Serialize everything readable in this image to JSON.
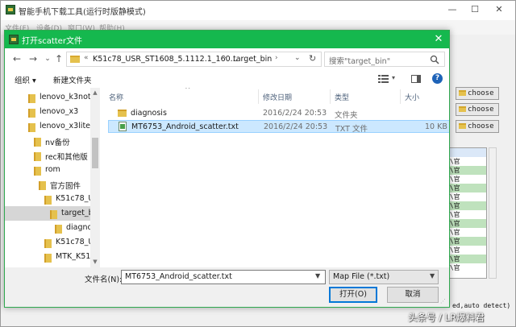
{
  "background_window": {
    "title": "智能手机下载工具(运行时版静模式)",
    "menu": [
      "文件(F)",
      "设备(D)",
      "窗口(W)",
      "帮助(H)"
    ],
    "controls": {
      "minimize": "—",
      "maximize": "☐",
      "close": "✕"
    },
    "choose_buttons": [
      "choose",
      "choose",
      "choose"
    ],
    "panel_rows": [
      "",
      "n\\官",
      "n\\官",
      "n\\官",
      "n\\官",
      "n\\官",
      "n\\官",
      "n\\官",
      "n\\官",
      "n\\官",
      "n\\官",
      "n\\官",
      "n\\官",
      "n\\官"
    ],
    "log_text": "ed,auto detect)"
  },
  "dialog": {
    "title": "打开scatter文件",
    "close": "✕",
    "nav": {
      "back": "←",
      "forward": "→",
      "dropdown": "⌄",
      "up": "↑"
    },
    "address": {
      "overflow": "«",
      "crumbs": [
        "K51c78_USR_ST1608_5.1112.1_160...",
        "target_bin"
      ],
      "separator": "›",
      "dropdown": "⌄",
      "refresh": "↻"
    },
    "search_placeholder": "搜索\"target_bin\"",
    "toolbar": {
      "organize": "组织 ▾",
      "new_folder": "新建文件夹",
      "view_dropdown": "▾",
      "help": "?"
    },
    "tree": [
      {
        "label": "lenovo_k3not",
        "indent": 0
      },
      {
        "label": "lenovo_x3",
        "indent": 0
      },
      {
        "label": "lenovo_x3lite",
        "indent": 0
      },
      {
        "label": "nv备份",
        "indent": 1
      },
      {
        "label": "rec和其他版",
        "indent": 1
      },
      {
        "label": "rom",
        "indent": 1
      },
      {
        "label": "官方固件",
        "indent": 2
      },
      {
        "label": "K51c78_U",
        "indent": 3
      },
      {
        "label": "target_b",
        "indent": 4,
        "selected": true
      },
      {
        "label": "diagno",
        "indent": 5
      },
      {
        "label": "K51c78_U",
        "indent": 3
      },
      {
        "label": "MTK_K51",
        "indent": 3
      }
    ],
    "columns": {
      "name": "名称",
      "modified": "修改日期",
      "type": "类型",
      "size": "大小"
    },
    "files": [
      {
        "name": "diagnosis",
        "modified": "2016/2/24 20:53",
        "type": "文件夹",
        "size": "",
        "kind": "folder"
      },
      {
        "name": "MT6753_Android_scatter.txt",
        "modified": "2016/2/24 20:53",
        "type": "TXT 文件",
        "size": "10 KB",
        "kind": "txt",
        "selected": true
      }
    ],
    "filename_label": "文件名(N):",
    "filename_value": "MT6753_Android_scatter.txt",
    "filter_value": "Map File (*.txt)",
    "open_button": "打开(O)",
    "cancel_button": "取消"
  },
  "watermark": "头条号 / LR爆料君",
  "colors": {
    "dialog_title": "#15b84e",
    "selection": "#cce8ff",
    "folder": "#e5c14d",
    "panel_highlight": "#bfe2bd"
  }
}
